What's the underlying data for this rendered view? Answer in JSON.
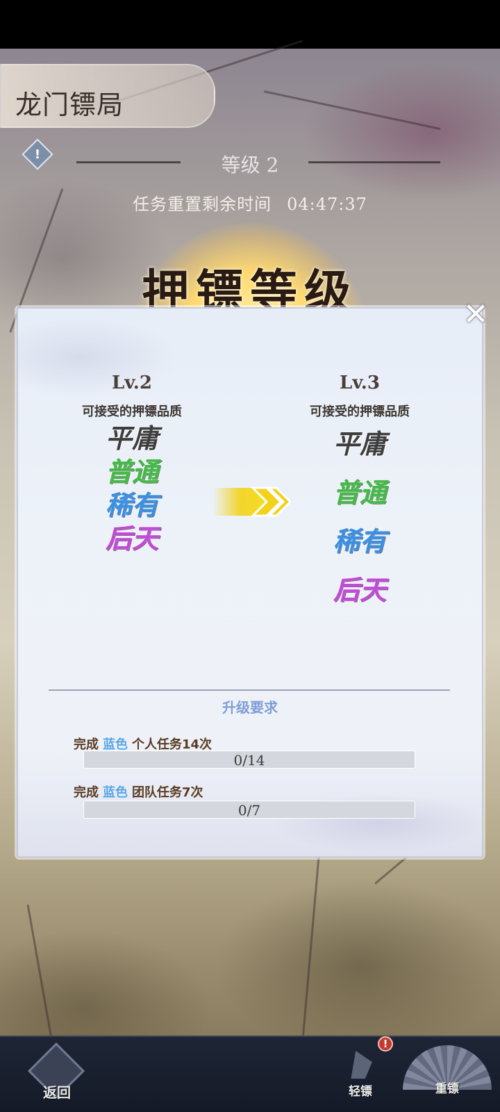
{
  "header": {
    "title": "龙门镖局",
    "level_label": "等级 2",
    "timer_label": "任务重置剩余时间",
    "timer_value": "04:47:37"
  },
  "banner": {
    "title": "押镖等级"
  },
  "upgrade": {
    "current": {
      "level": "Lv.2",
      "subtitle": "可接受的押镖品质",
      "qualities": [
        "平庸",
        "普通",
        "稀有",
        "后天"
      ]
    },
    "next": {
      "level": "Lv.3",
      "subtitle": "可接受的押镖品质",
      "qualities": [
        "平庸",
        "普通",
        "稀有",
        "后天"
      ]
    },
    "requirements_title": "升级要求",
    "requirements": [
      {
        "prefix": "完成",
        "color_word": "蓝色",
        "task": "个人任务14次",
        "progress_text": "0/14",
        "progress": 0
      },
      {
        "prefix": "完成",
        "color_word": "蓝色",
        "task": "团队任务7次",
        "progress_text": "0/7",
        "progress": 0
      }
    ]
  },
  "colors": {
    "quality_gray": "#3e3e3e",
    "quality_green": "#46b84a",
    "quality_blue": "#3a8fe0",
    "quality_purple": "#c24ad8",
    "requirement_color_word": "#5aa7e6",
    "arrow": "#f2d21a"
  },
  "bottom_nav": {
    "back_label": "返回",
    "light_escort_label": "轻镖",
    "light_escort_badge": "!",
    "heavy_escort_label": "重镖"
  }
}
